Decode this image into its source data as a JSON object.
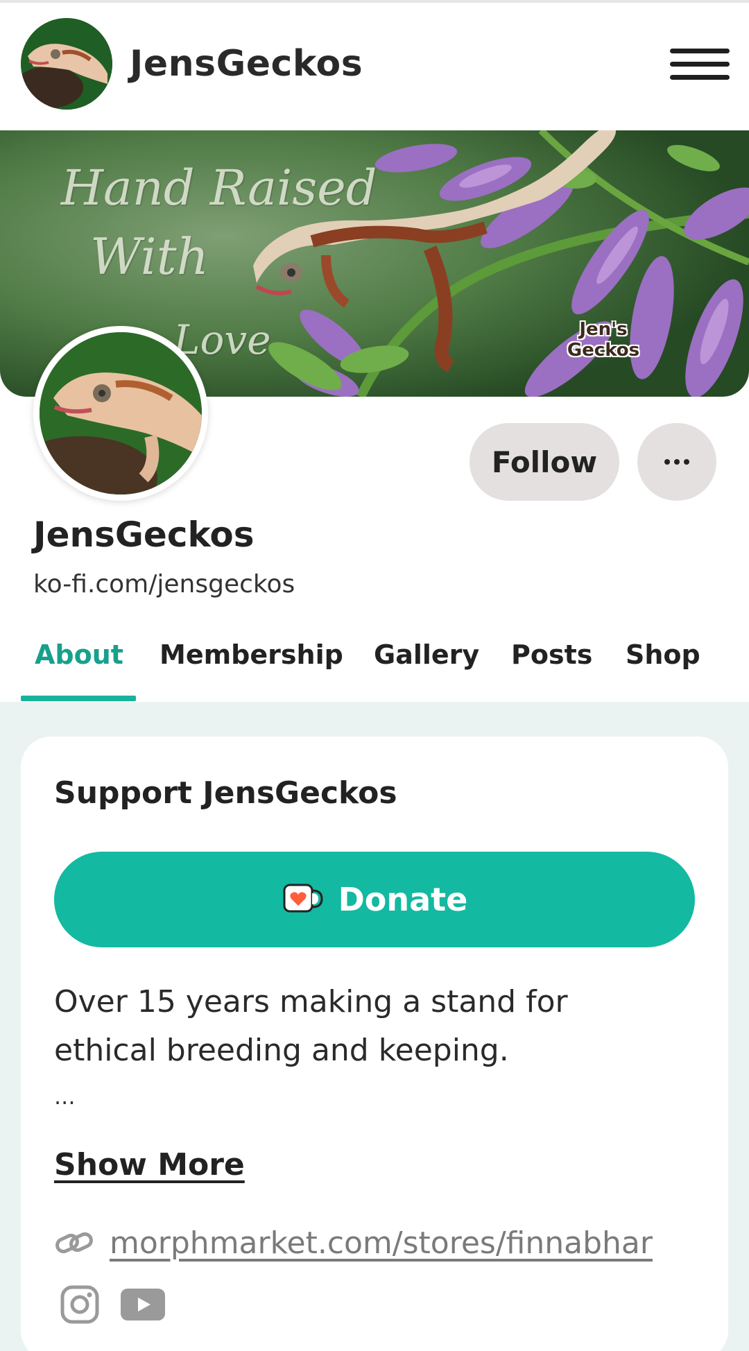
{
  "header": {
    "title": "JensGeckos",
    "menu_icon": "hamburger-menu-icon"
  },
  "banner": {
    "line1": "Hand Raised",
    "line2": "With",
    "line3": "Love",
    "brand_line1": "Jen's",
    "brand_line2": "Geckos"
  },
  "profile": {
    "name": "JensGeckos",
    "url": "ko-fi.com/jensgeckos",
    "follow_label": "Follow",
    "more_icon": "more-options-icon"
  },
  "tabs": [
    {
      "label": "About",
      "active": true
    },
    {
      "label": "Membership",
      "active": false
    },
    {
      "label": "Gallery",
      "active": false
    },
    {
      "label": "Posts",
      "active": false
    },
    {
      "label": "Shop",
      "active": false
    }
  ],
  "support_card": {
    "title": "Support JensGeckos",
    "donate_label": "Donate",
    "donate_icon": "kofi-cup-icon",
    "about_text": "Over 15 years making a stand for ethical breeding and keeping.",
    "ellipsis": "...",
    "show_more_label": "Show More",
    "link_icon": "link-icon",
    "link_text": "morphmarket.com/stores/finnabhar",
    "social_icons": [
      "instagram-icon",
      "youtube-icon"
    ]
  },
  "colors": {
    "accent": "#13b9a0",
    "active_tab": "#17a08c",
    "button_gray": "#e4e0df",
    "content_bg": "#eaf3f2"
  }
}
